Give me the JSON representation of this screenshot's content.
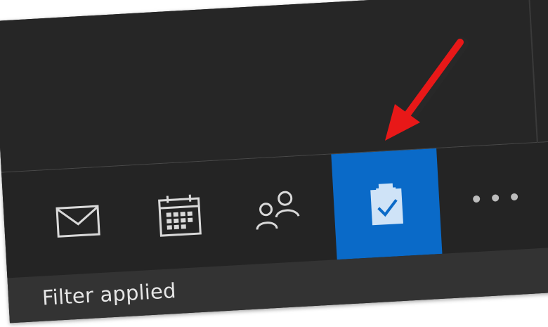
{
  "nav": {
    "items": [
      {
        "id": "mail",
        "icon": "mail-icon",
        "selected": false
      },
      {
        "id": "calendar",
        "icon": "calendar-icon",
        "selected": false
      },
      {
        "id": "people",
        "icon": "people-icon",
        "selected": false
      },
      {
        "id": "tasks",
        "icon": "tasks-clipboard-icon",
        "selected": true
      },
      {
        "id": "more",
        "icon": "more-dots-icon",
        "selected": false
      }
    ]
  },
  "status": {
    "text": "Filter applied"
  },
  "colors": {
    "background": "#262626",
    "nav_selected": "#0a6ac8",
    "icon": "#d9d9d9",
    "icon_selected": "#cfe3f7",
    "status_bar": "#333333",
    "arrow": "#e81818"
  },
  "annotation": {
    "icon": "red-arrow"
  }
}
